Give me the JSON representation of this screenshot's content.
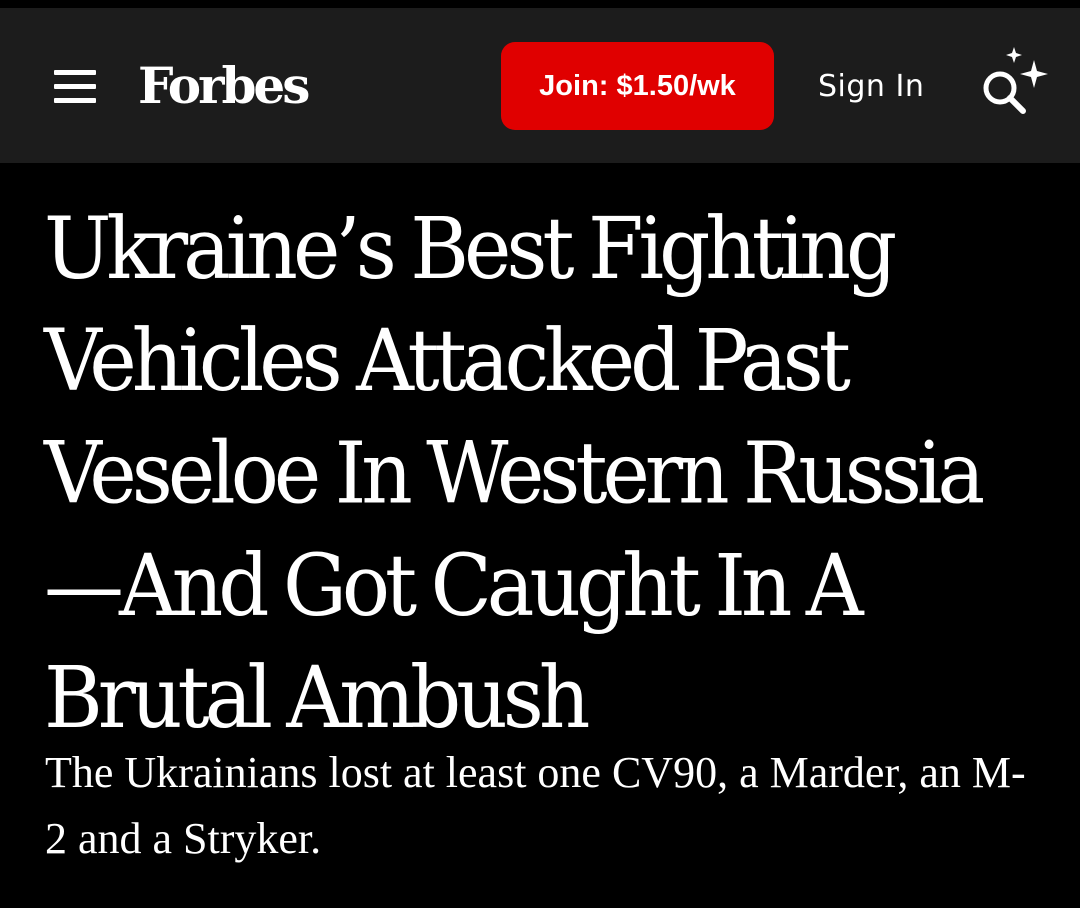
{
  "colors": {
    "header_background": "#1c1c1c",
    "page_background": "#000000",
    "join_button": "#e00000",
    "text": "#ffffff"
  },
  "header": {
    "menu_icon": "hamburger-menu-icon",
    "logo": "Forbes",
    "join_label": "Join: $1.50/wk",
    "signin_label": "Sign In",
    "search_icon": "ai-search-sparkle-icon"
  },
  "article": {
    "headline": "Ukraine’s Best Fighting Vehicles Attacked Past Veseloe In Western Russia—And Got Caught In A Brutal Ambush",
    "subheadline": "The Ukrainians lost at least one CV90, a Marder, an M-2 and a Stryker."
  }
}
